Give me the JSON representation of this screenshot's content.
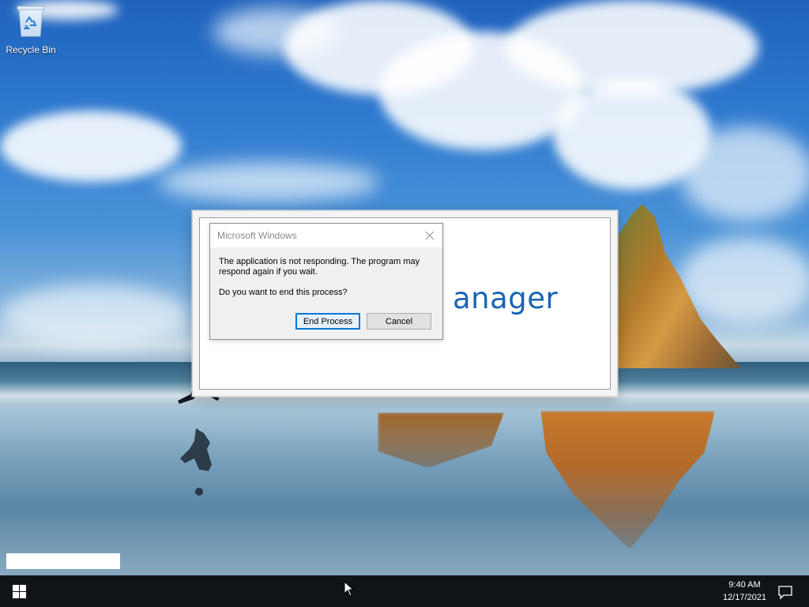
{
  "desktop": {
    "icons": [
      {
        "label": "Recycle Bin",
        "icon": "recycle-bin-icon"
      }
    ]
  },
  "background_window": {
    "splash_text": "anager"
  },
  "dialog": {
    "title": "Microsoft Windows",
    "message_line1": "The application is not responding. The program may",
    "message_line2": "respond again if you wait.",
    "question": "Do you want to end this process?",
    "buttons": {
      "end_process": "End Process",
      "cancel": "Cancel"
    }
  },
  "taskbar": {
    "start_icon": "windows-logo-icon",
    "time": "9:40 AM",
    "date": "12/17/2021",
    "notification_icon": "action-center-icon"
  },
  "colors": {
    "accent": "#0078d7",
    "taskbar": "#101418",
    "splash_text": "#1a64b4"
  }
}
